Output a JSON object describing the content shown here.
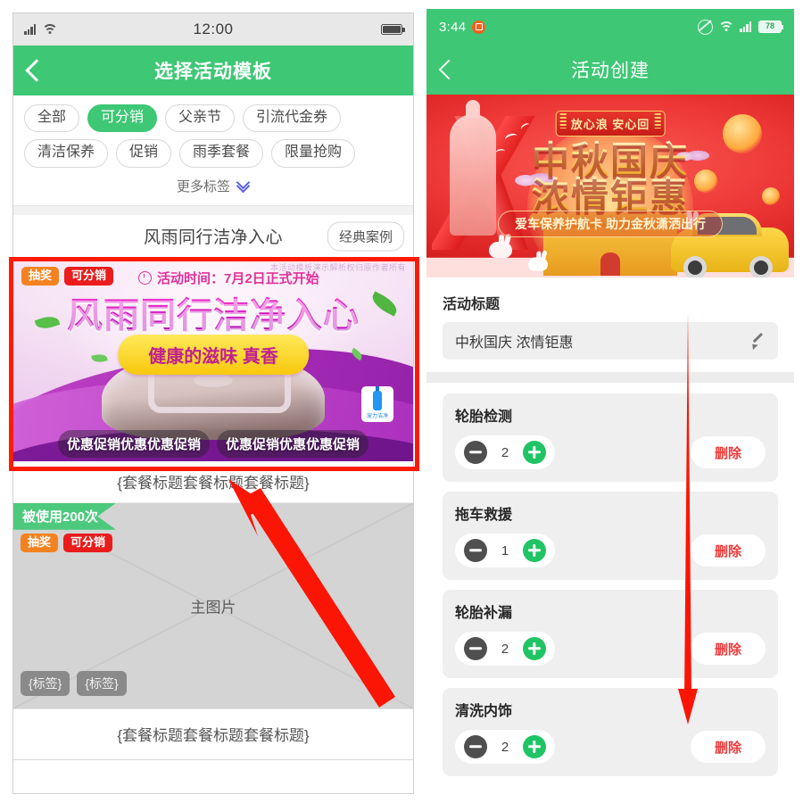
{
  "left_phone": {
    "status_bar": {
      "time": "12:00",
      "signal_icon": "signal-icon",
      "wifi_icon": "wifi-icon",
      "battery_icon": "battery-icon"
    },
    "nav": {
      "back_icon": "back-chevron-icon",
      "title": "选择活动模板"
    },
    "filters": {
      "row1": [
        {
          "label": "全部",
          "selected": false
        },
        {
          "label": "可分销",
          "selected": true
        },
        {
          "label": "父亲节",
          "selected": false
        },
        {
          "label": "引流代金券",
          "selected": false
        }
      ],
      "row2": [
        {
          "label": "清洁保养",
          "selected": false
        },
        {
          "label": "促销",
          "selected": false
        },
        {
          "label": "雨季套餐",
          "selected": false
        },
        {
          "label": "限量抢购",
          "selected": false
        }
      ],
      "more_label": "更多标签",
      "more_icon": "double-chevron-down-icon"
    },
    "card_selected": {
      "title": "风雨同行洁净入心",
      "case_button": "经典案例",
      "badges": [
        {
          "label": "抽奖",
          "color": "#f58220"
        },
        {
          "label": "可分销",
          "color": "#ea1c1c"
        }
      ],
      "time_text": "活动时间：7月2日正式开始",
      "clock_icon": "clock-icon",
      "watermark": "本活动模板演示解析权归原作者所有",
      "banner_title": "风雨同行洁净入心",
      "banner_sub": "健康的滋味  真香",
      "bottle_label": "宠力洁净",
      "ribbon": [
        "优惠促销优惠优惠促销",
        "优惠促销优惠优惠促销"
      ],
      "footer_title": "{套餐标题套餐标题套餐标题}",
      "highlight_color": "#ff1a00"
    },
    "card_second": {
      "used_flag": "被使用200次",
      "badges": [
        {
          "label": "抽奖",
          "color": "#f58220"
        },
        {
          "label": "可分销",
          "color": "#ea1c1c"
        }
      ],
      "placeholder_label": "主图片",
      "tags": [
        "{标签}",
        "{标签}"
      ],
      "footer_title": "{套餐标题套餐标题套餐标题}"
    },
    "annotation": {
      "arrow_icon": "red-arrow-up-left-icon",
      "color": "#ff2200"
    }
  },
  "right_phone": {
    "status_bar": {
      "time": "3:44",
      "notif_icon": "app-notification-icon",
      "mute_icon": "mute-icon",
      "wifi_icon": "wifi-icon",
      "signal_icon": "signal-icon",
      "battery_level": "78"
    },
    "nav": {
      "back_icon": "back-chevron-icon",
      "title": "活动创建"
    },
    "banner": {
      "plaque": "放心浪 安心回",
      "line1": "中秋国庆",
      "line2": "浓情钜惠",
      "pill": "爱车保养护航卡  助力金秋潇洒出行"
    },
    "form": {
      "title_label": "活动标题",
      "title_value": "中秋国庆 浓情钜惠",
      "edit_icon": "pencil-icon"
    },
    "services": [
      {
        "name": "轮胎检测",
        "qty": "2",
        "delete_label": "删除"
      },
      {
        "name": "拖车救援",
        "qty": "1",
        "delete_label": "删除"
      },
      {
        "name": "轮胎补漏",
        "qty": "2",
        "delete_label": "删除"
      },
      {
        "name": "清洗内饰",
        "qty": "2",
        "delete_label": "删除"
      }
    ],
    "stepper_icons": {
      "minus": "minus-circle-icon",
      "plus": "plus-circle-icon"
    },
    "annotation": {
      "arrow_icon": "red-arrow-down-icon",
      "color": "#ff2200"
    }
  }
}
